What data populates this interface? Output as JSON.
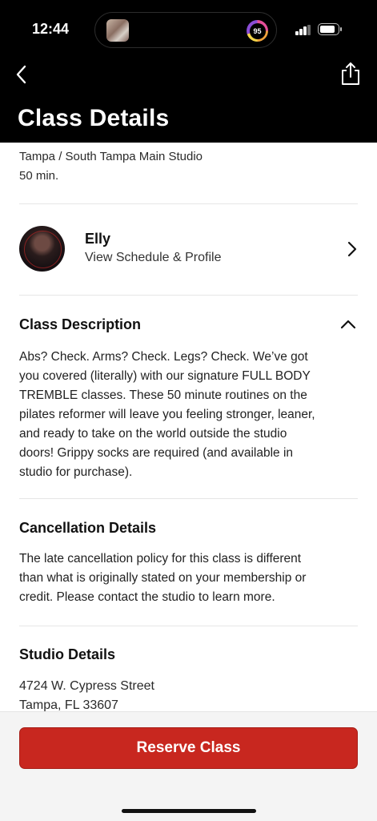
{
  "status_bar": {
    "time": "12:44",
    "activity_ring_value": "95",
    "signal_icon": "cellular-signal-icon",
    "battery_icon": "battery-icon"
  },
  "header": {
    "title": "Class Details",
    "back_icon": "chevron-left-icon",
    "share_icon": "share-icon"
  },
  "class_info": {
    "location": "Tampa / South Tampa Main Studio",
    "duration": "50 min."
  },
  "instructor": {
    "name": "Elly",
    "link_text": "View Schedule & Profile"
  },
  "description": {
    "title": "Class Description",
    "lines": [
      "Abs? Check. Arms? Check. Legs? Check. We’ve got",
      "you covered (literally) with our signature FULL BODY",
      "TREMBLE classes. These 50 minute routines on the",
      "pilates reformer will leave you feeling stronger, leaner,",
      "and ready to take on the world outside the studio",
      "doors! Grippy socks are required (and available in",
      "studio for purchase)."
    ]
  },
  "cancellation": {
    "title": "Cancellation Details",
    "lines": [
      "The late cancellation policy for this class is different",
      "than what is originally stated on your membership or",
      "credit. Please contact the studio to learn more."
    ]
  },
  "studio": {
    "title": "Studio Details",
    "address_line1": "4724 W. Cypress Street",
    "address_line2": "Tampa, FL 33607"
  },
  "actions": {
    "reserve_label": "Reserve Class"
  },
  "colors": {
    "header_bg": "#000000",
    "accent_red": "#c8271f"
  }
}
